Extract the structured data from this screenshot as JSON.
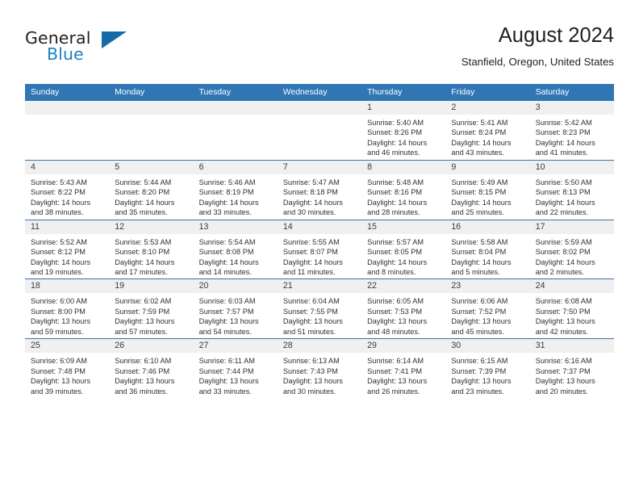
{
  "brand": {
    "name_part1": "General",
    "name_part2": "Blue",
    "triangle_color": "#1769a8",
    "blue_color": "#1c7fc4"
  },
  "header": {
    "title": "August 2024",
    "subtitle": "Stanfield, Oregon, United States"
  },
  "theme": {
    "header_bar_color": "#3076b5",
    "day_number_band_color": "#f0f0f0",
    "text_color": "#303030"
  },
  "calendar": {
    "weekdays": [
      "Sunday",
      "Monday",
      "Tuesday",
      "Wednesday",
      "Thursday",
      "Friday",
      "Saturday"
    ],
    "weeks": [
      [
        {
          "day": "",
          "sunrise": "",
          "sunset": "",
          "daylight_line1": "",
          "daylight_line2": ""
        },
        {
          "day": "",
          "sunrise": "",
          "sunset": "",
          "daylight_line1": "",
          "daylight_line2": ""
        },
        {
          "day": "",
          "sunrise": "",
          "sunset": "",
          "daylight_line1": "",
          "daylight_line2": ""
        },
        {
          "day": "",
          "sunrise": "",
          "sunset": "",
          "daylight_line1": "",
          "daylight_line2": ""
        },
        {
          "day": "1",
          "sunrise": "Sunrise: 5:40 AM",
          "sunset": "Sunset: 8:26 PM",
          "daylight_line1": "Daylight: 14 hours",
          "daylight_line2": "and 46 minutes."
        },
        {
          "day": "2",
          "sunrise": "Sunrise: 5:41 AM",
          "sunset": "Sunset: 8:24 PM",
          "daylight_line1": "Daylight: 14 hours",
          "daylight_line2": "and 43 minutes."
        },
        {
          "day": "3",
          "sunrise": "Sunrise: 5:42 AM",
          "sunset": "Sunset: 8:23 PM",
          "daylight_line1": "Daylight: 14 hours",
          "daylight_line2": "and 41 minutes."
        }
      ],
      [
        {
          "day": "4",
          "sunrise": "Sunrise: 5:43 AM",
          "sunset": "Sunset: 8:22 PM",
          "daylight_line1": "Daylight: 14 hours",
          "daylight_line2": "and 38 minutes."
        },
        {
          "day": "5",
          "sunrise": "Sunrise: 5:44 AM",
          "sunset": "Sunset: 8:20 PM",
          "daylight_line1": "Daylight: 14 hours",
          "daylight_line2": "and 35 minutes."
        },
        {
          "day": "6",
          "sunrise": "Sunrise: 5:46 AM",
          "sunset": "Sunset: 8:19 PM",
          "daylight_line1": "Daylight: 14 hours",
          "daylight_line2": "and 33 minutes."
        },
        {
          "day": "7",
          "sunrise": "Sunrise: 5:47 AM",
          "sunset": "Sunset: 8:18 PM",
          "daylight_line1": "Daylight: 14 hours",
          "daylight_line2": "and 30 minutes."
        },
        {
          "day": "8",
          "sunrise": "Sunrise: 5:48 AM",
          "sunset": "Sunset: 8:16 PM",
          "daylight_line1": "Daylight: 14 hours",
          "daylight_line2": "and 28 minutes."
        },
        {
          "day": "9",
          "sunrise": "Sunrise: 5:49 AM",
          "sunset": "Sunset: 8:15 PM",
          "daylight_line1": "Daylight: 14 hours",
          "daylight_line2": "and 25 minutes."
        },
        {
          "day": "10",
          "sunrise": "Sunrise: 5:50 AM",
          "sunset": "Sunset: 8:13 PM",
          "daylight_line1": "Daylight: 14 hours",
          "daylight_line2": "and 22 minutes."
        }
      ],
      [
        {
          "day": "11",
          "sunrise": "Sunrise: 5:52 AM",
          "sunset": "Sunset: 8:12 PM",
          "daylight_line1": "Daylight: 14 hours",
          "daylight_line2": "and 19 minutes."
        },
        {
          "day": "12",
          "sunrise": "Sunrise: 5:53 AM",
          "sunset": "Sunset: 8:10 PM",
          "daylight_line1": "Daylight: 14 hours",
          "daylight_line2": "and 17 minutes."
        },
        {
          "day": "13",
          "sunrise": "Sunrise: 5:54 AM",
          "sunset": "Sunset: 8:08 PM",
          "daylight_line1": "Daylight: 14 hours",
          "daylight_line2": "and 14 minutes."
        },
        {
          "day": "14",
          "sunrise": "Sunrise: 5:55 AM",
          "sunset": "Sunset: 8:07 PM",
          "daylight_line1": "Daylight: 14 hours",
          "daylight_line2": "and 11 minutes."
        },
        {
          "day": "15",
          "sunrise": "Sunrise: 5:57 AM",
          "sunset": "Sunset: 8:05 PM",
          "daylight_line1": "Daylight: 14 hours",
          "daylight_line2": "and 8 minutes."
        },
        {
          "day": "16",
          "sunrise": "Sunrise: 5:58 AM",
          "sunset": "Sunset: 8:04 PM",
          "daylight_line1": "Daylight: 14 hours",
          "daylight_line2": "and 5 minutes."
        },
        {
          "day": "17",
          "sunrise": "Sunrise: 5:59 AM",
          "sunset": "Sunset: 8:02 PM",
          "daylight_line1": "Daylight: 14 hours",
          "daylight_line2": "and 2 minutes."
        }
      ],
      [
        {
          "day": "18",
          "sunrise": "Sunrise: 6:00 AM",
          "sunset": "Sunset: 8:00 PM",
          "daylight_line1": "Daylight: 13 hours",
          "daylight_line2": "and 59 minutes."
        },
        {
          "day": "19",
          "sunrise": "Sunrise: 6:02 AM",
          "sunset": "Sunset: 7:59 PM",
          "daylight_line1": "Daylight: 13 hours",
          "daylight_line2": "and 57 minutes."
        },
        {
          "day": "20",
          "sunrise": "Sunrise: 6:03 AM",
          "sunset": "Sunset: 7:57 PM",
          "daylight_line1": "Daylight: 13 hours",
          "daylight_line2": "and 54 minutes."
        },
        {
          "day": "21",
          "sunrise": "Sunrise: 6:04 AM",
          "sunset": "Sunset: 7:55 PM",
          "daylight_line1": "Daylight: 13 hours",
          "daylight_line2": "and 51 minutes."
        },
        {
          "day": "22",
          "sunrise": "Sunrise: 6:05 AM",
          "sunset": "Sunset: 7:53 PM",
          "daylight_line1": "Daylight: 13 hours",
          "daylight_line2": "and 48 minutes."
        },
        {
          "day": "23",
          "sunrise": "Sunrise: 6:06 AM",
          "sunset": "Sunset: 7:52 PM",
          "daylight_line1": "Daylight: 13 hours",
          "daylight_line2": "and 45 minutes."
        },
        {
          "day": "24",
          "sunrise": "Sunrise: 6:08 AM",
          "sunset": "Sunset: 7:50 PM",
          "daylight_line1": "Daylight: 13 hours",
          "daylight_line2": "and 42 minutes."
        }
      ],
      [
        {
          "day": "25",
          "sunrise": "Sunrise: 6:09 AM",
          "sunset": "Sunset: 7:48 PM",
          "daylight_line1": "Daylight: 13 hours",
          "daylight_line2": "and 39 minutes."
        },
        {
          "day": "26",
          "sunrise": "Sunrise: 6:10 AM",
          "sunset": "Sunset: 7:46 PM",
          "daylight_line1": "Daylight: 13 hours",
          "daylight_line2": "and 36 minutes."
        },
        {
          "day": "27",
          "sunrise": "Sunrise: 6:11 AM",
          "sunset": "Sunset: 7:44 PM",
          "daylight_line1": "Daylight: 13 hours",
          "daylight_line2": "and 33 minutes."
        },
        {
          "day": "28",
          "sunrise": "Sunrise: 6:13 AM",
          "sunset": "Sunset: 7:43 PM",
          "daylight_line1": "Daylight: 13 hours",
          "daylight_line2": "and 30 minutes."
        },
        {
          "day": "29",
          "sunrise": "Sunrise: 6:14 AM",
          "sunset": "Sunset: 7:41 PM",
          "daylight_line1": "Daylight: 13 hours",
          "daylight_line2": "and 26 minutes."
        },
        {
          "day": "30",
          "sunrise": "Sunrise: 6:15 AM",
          "sunset": "Sunset: 7:39 PM",
          "daylight_line1": "Daylight: 13 hours",
          "daylight_line2": "and 23 minutes."
        },
        {
          "day": "31",
          "sunrise": "Sunrise: 6:16 AM",
          "sunset": "Sunset: 7:37 PM",
          "daylight_line1": "Daylight: 13 hours",
          "daylight_line2": "and 20 minutes."
        }
      ]
    ]
  }
}
